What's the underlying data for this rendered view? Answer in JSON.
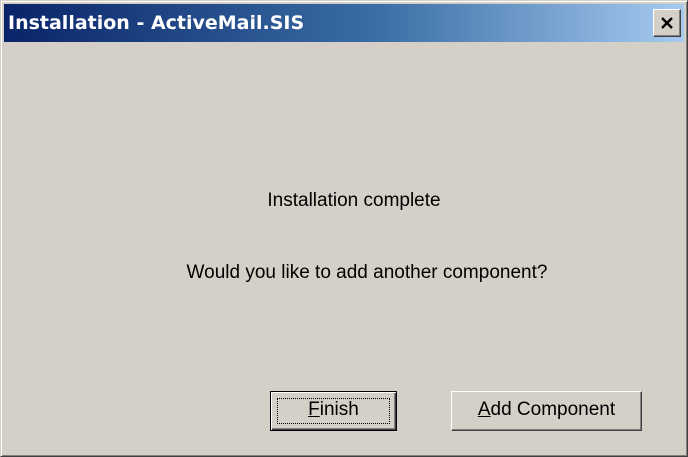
{
  "window": {
    "title": "Installation - ActiveMail.SIS",
    "close_icon": "close-icon"
  },
  "dialog": {
    "message_primary": "Installation complete",
    "message_secondary": "Would you like to add another component?"
  },
  "buttons": {
    "finish": {
      "mnemonic": "F",
      "rest": "inish"
    },
    "add_component": {
      "mnemonic": "A",
      "rest": "dd Component"
    }
  },
  "colors": {
    "titlebar_start": "#0a246a",
    "titlebar_end": "#a6caf0",
    "face": "#d4d0c8"
  }
}
